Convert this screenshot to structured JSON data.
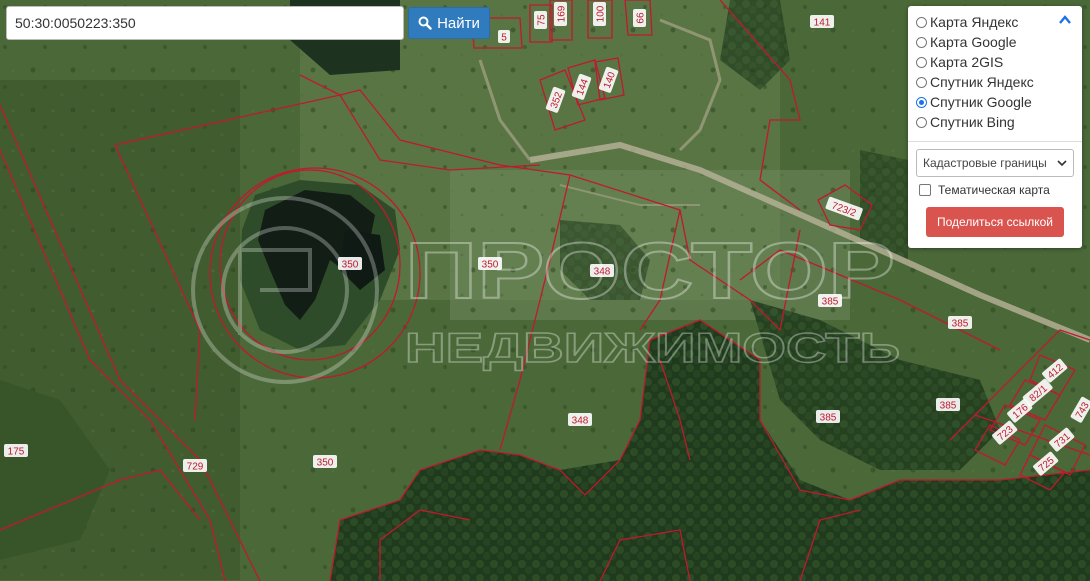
{
  "search": {
    "value": "50:30:0050223:350",
    "button_label": "Найти"
  },
  "layers": {
    "options": [
      {
        "label": "Карта Яндекс",
        "checked": false
      },
      {
        "label": "Карта Google",
        "checked": false
      },
      {
        "label": "Карта 2GIS",
        "checked": false
      },
      {
        "label": "Спутник Яндекс",
        "checked": false
      },
      {
        "label": "Спутник Google",
        "checked": true
      },
      {
        "label": "Спутник Bing",
        "checked": false
      }
    ],
    "overlay_select": "Кадастровые границы",
    "thematic_label": "Тематическая карта",
    "share_label": "Поделиться ссылкой"
  },
  "watermark": {
    "line1": "ПРОСТОР",
    "line2": "НЕДВИЖИМОСТЬ"
  },
  "parcel_labels": [
    "350",
    "350",
    "350",
    "348",
    "348",
    "385",
    "385",
    "385",
    "385",
    "729",
    "175",
    "141",
    "5",
    "75",
    "169",
    "100",
    "66",
    "352",
    "144",
    "140",
    "723/2",
    "412",
    "82/1",
    "176",
    "723",
    "731",
    "725",
    "743"
  ],
  "colors": {
    "accent_blue": "#2f7bbd",
    "share_red": "#d9534f",
    "parcel_line": "#c0192f"
  }
}
